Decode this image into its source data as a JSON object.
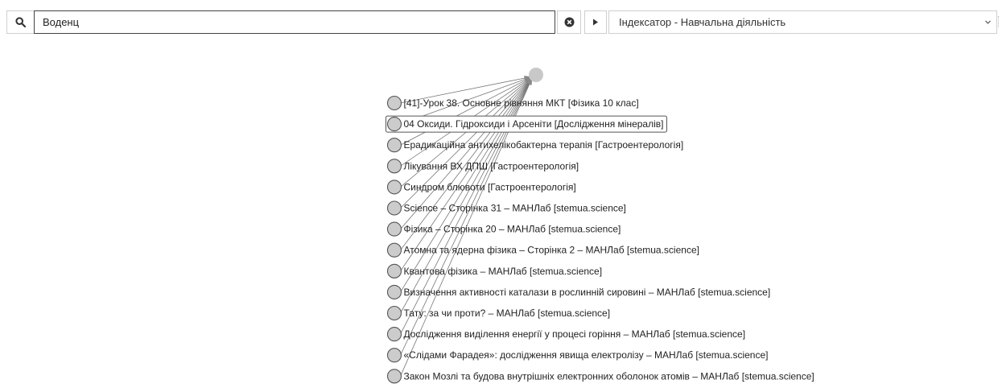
{
  "search": {
    "value": "Воденц",
    "search_icon": "search-icon",
    "clear_icon": "close-circle-icon"
  },
  "source": {
    "play_icon": "play-icon",
    "selected": "Індексатор - Навчальна діяльність",
    "chevron_icon": "chevron-down-icon"
  },
  "graph": {
    "hub_color": "#c8c8c8",
    "node_color": "#cccccc",
    "edge_color": "#777777",
    "selected_index": 1,
    "nodes": [
      "[41]-Урок 38.  Основне рівняння МКТ [Фізика 10 клас]",
      "04 Оксиди. Гідроксиди і Арсеніти [Дослідження мінералів]",
      "Ерадикаційна антихелікобактерна терапія [Гастроентерологія]",
      "Лікування ВХ ДПШ [Гастроентерологія]",
      "Синдром блювоти [Гастроентерологія]",
      "Science – Сторінка 31 – МАНЛаб [stemua.science]",
      "Фізика – Сторінка 20 – МАНЛаб [stemua.science]",
      "Атомна та ядерна фізика – Сторінка 2 – МАНЛаб [stemua.science]",
      "Квантова фізика – МАНЛаб [stemua.science]",
      "Визначення активності каталази в рослинній сировині – МАНЛаб [stemua.science]",
      "Тату: за чи проти? – МАНЛаб [stemua.science]",
      "Дослідження виділення енергії у процесі горіння – МАНЛаб [stemua.science]",
      "«Слідами Фарадея»: дослідження явища електролізу – МАНЛаб [stemua.science]",
      "Закон Мозлі та будова внутрішніх електронних оболонок атомів – МАНЛаб [stemua.science]"
    ]
  }
}
